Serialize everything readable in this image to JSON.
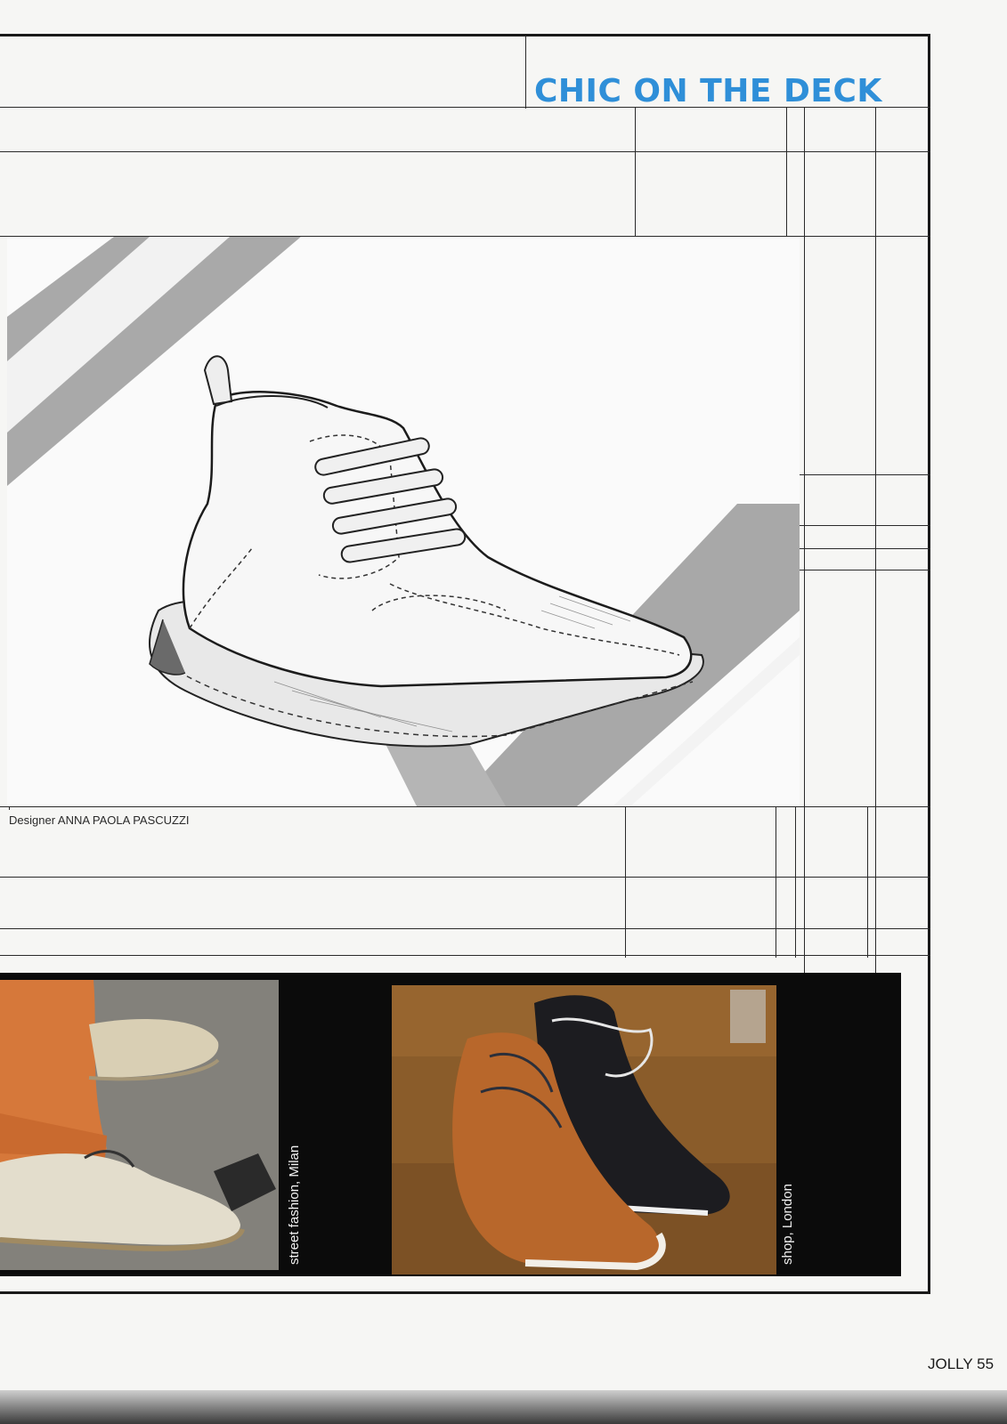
{
  "article": {
    "title": "CHIC ON THE DECK",
    "credit": "Designer ANNA PAOLA PASCUZZI"
  },
  "photos": [
    {
      "caption": "street fashion, Milan",
      "subject": "beige lace-up espadrille with orange cuffed trousers"
    },
    {
      "caption": "shop, London",
      "subject": "tan and black leather boat-shoe chukkas on wooden floor"
    }
  ],
  "footer": {
    "folio": "JOLLY 55"
  },
  "colors": {
    "title": "#2f8fd8",
    "frame": "#1a1a1a",
    "strip": "#0b0b0b"
  }
}
